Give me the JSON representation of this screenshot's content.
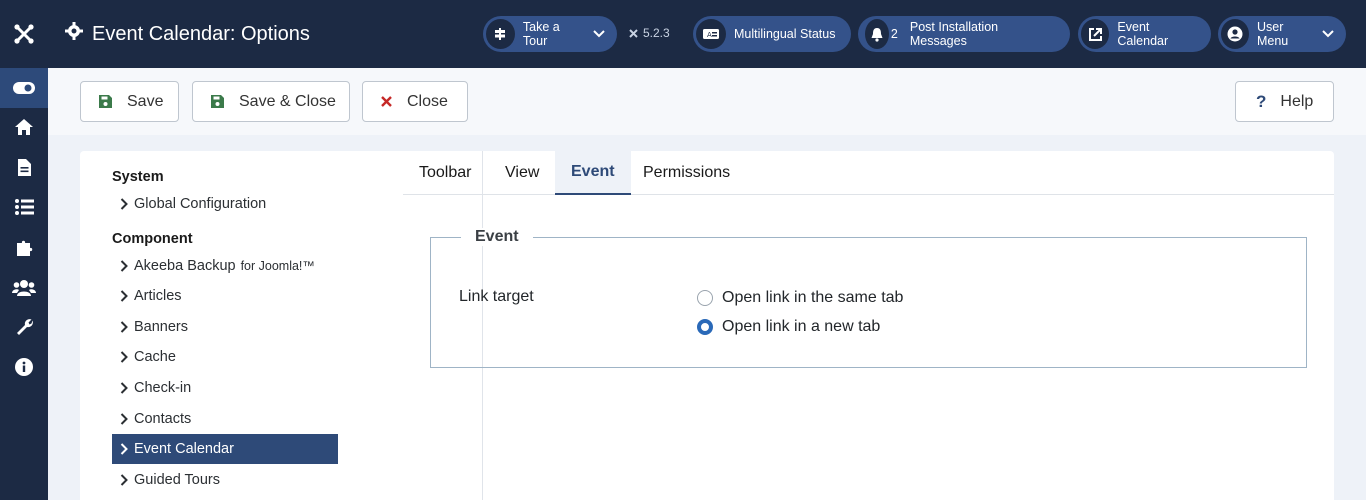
{
  "header": {
    "title": "Event Calendar: Options",
    "take_tour": "Take a Tour",
    "version": "5.2.3",
    "multilingual": "Multilingual Status",
    "notif_count": "2",
    "post_install": "Post Installation Messages",
    "event_calendar_link": "Event Calendar",
    "user_menu": "User Menu"
  },
  "sidebar": {
    "icons": [
      "toggle-icon",
      "home-icon",
      "file-icon",
      "list-icon",
      "puzzle-icon",
      "users-icon",
      "wrench-icon",
      "info-icon"
    ]
  },
  "toolbar": {
    "save": "Save",
    "save_close": "Save & Close",
    "close": "Close",
    "help": "Help"
  },
  "nav": {
    "system_head": "System",
    "global_config": "Global Configuration",
    "component_head": "Component",
    "items": [
      {
        "label": "Akeeba Backup",
        "small": "for Joomla!™"
      },
      {
        "label": "Articles"
      },
      {
        "label": "Banners"
      },
      {
        "label": "Cache"
      },
      {
        "label": "Check-in"
      },
      {
        "label": "Contacts"
      },
      {
        "label": "Event Calendar",
        "active": true
      },
      {
        "label": "Guided Tours"
      }
    ]
  },
  "tabs": [
    "Toolbar",
    "View",
    "Event",
    "Permissions"
  ],
  "active_tab": "Event",
  "fieldset": {
    "legend": "Event",
    "label": "Link target",
    "options": [
      {
        "label": "Open link in the same tab",
        "checked": false
      },
      {
        "label": "Open link in a new tab",
        "checked": true
      }
    ]
  },
  "colors": {
    "header_bg": "#1c2a44",
    "accent": "#2e4a78",
    "radio_checked": "#2a69b8"
  }
}
